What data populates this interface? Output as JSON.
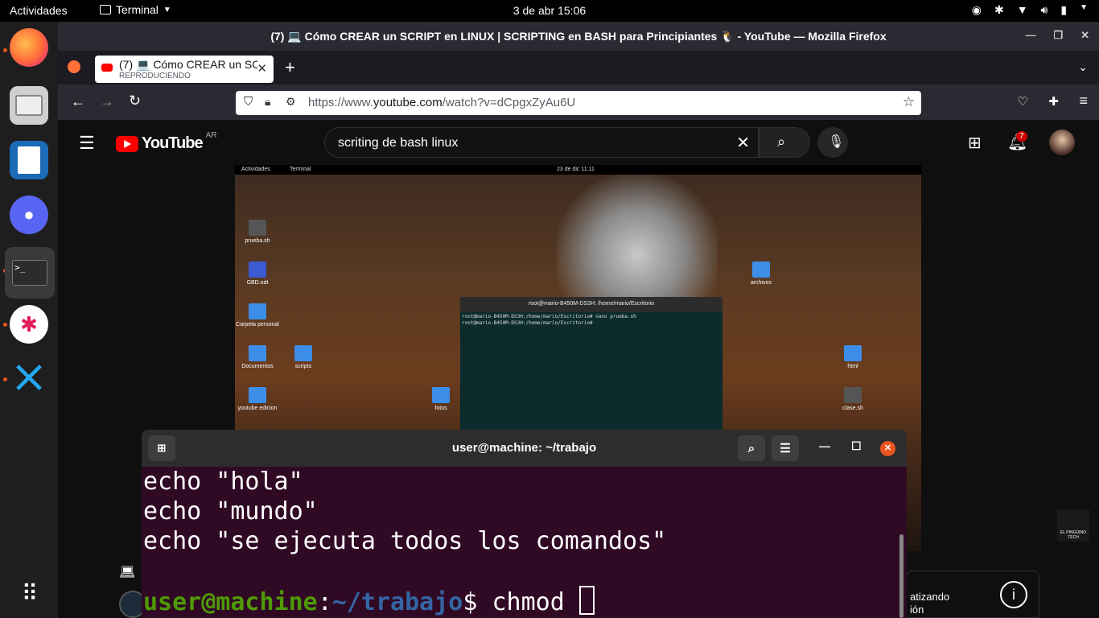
{
  "topbar": {
    "activities": "Actividades",
    "app_name": "Terminal",
    "clock": "3 de abr  15:06"
  },
  "dock": {
    "items": [
      "firefox",
      "files",
      "writer",
      "discord",
      "terminal",
      "slack",
      "vscode",
      "show-apps"
    ]
  },
  "firefox": {
    "window_title": "(7) 💻 Cómo CREAR un SCRIPT en LINUX | SCRIPTING en BASH para Principiantes 🐧 - YouTube — Mozilla Firefox",
    "tab_title": "(7) 💻 Cómo CREAR un SC",
    "tab_subtitle": "REPRODUCIENDO",
    "url_prefix": "https://www.",
    "url_domain": "youtube.com",
    "url_path": "/watch?v=dCpgxZyAu6U"
  },
  "youtube": {
    "logo": "YouTube",
    "region": "AR",
    "search_query": "scriting de bash linux",
    "notifications": "7",
    "overlay_text_1": "atizando",
    "overlay_text_2": "ión",
    "watermark": "EL PINGÜINO TECH"
  },
  "video": {
    "topbar_left": "Actividades",
    "topbar_app": "Terminal",
    "topbar_clock": "23 de dic  11:11",
    "desktop_icons": [
      {
        "label": "prueba.sh",
        "kind": "file"
      },
      {
        "label": "GBD.odt",
        "kind": "doc"
      },
      {
        "label": "Carpeta personal",
        "kind": "folder"
      },
      {
        "label": "Documentos",
        "kind": "folder"
      },
      {
        "label": "scripts",
        "kind": "folder"
      },
      {
        "label": "youtube edicion",
        "kind": "folder"
      },
      {
        "label": "fotos",
        "kind": "folder"
      },
      {
        "label": "archivos",
        "kind": "folder"
      },
      {
        "label": "html",
        "kind": "folder"
      },
      {
        "label": "clase.sh",
        "kind": "file"
      }
    ],
    "term_title": "root@mario-B450M-DS3H: /home/mario/Escritorio",
    "term_line1": "root@mario-B450M-DS3H:/home/mario/Escritorio# nano prueba.sh",
    "term_line2": "root@mario-B450M-DS3H:/home/mario/Escritorio# "
  },
  "terminal": {
    "title": "user@machine: ~/trabajo",
    "lines": [
      "echo \"hola\"",
      "echo \"mundo\"",
      "echo \"se ejecuta todos los comandos\""
    ],
    "prompt_user": "user@machine",
    "prompt_sep": ":",
    "prompt_path": "~/trabajo",
    "prompt_end": "$ ",
    "command": "chmod "
  }
}
